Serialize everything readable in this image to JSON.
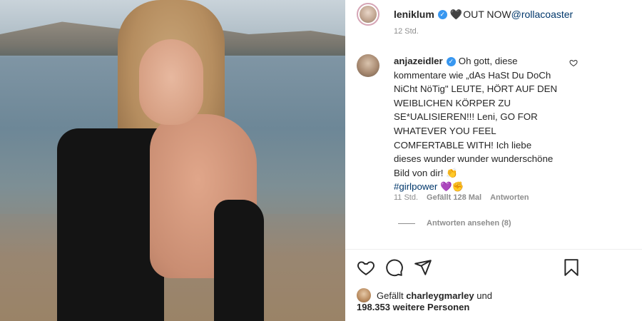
{
  "post": {
    "author": "leniklum",
    "caption_prefix": "🖤",
    "caption_text": "OUT NOW ",
    "caption_handle": "@rollacoaster",
    "timestamp": "12 Std."
  },
  "comment": {
    "author": "anjazeidler",
    "text": "Oh gott, diese kommentare wie „dAs HaSt Du DoCh NiCht NöTig\" LEUTE, HÖRT AUF DEN WEIBLICHEN KÖRPER ZU SE*UALISIEREN!!! Leni, GO FOR WHATEVER YOU FEEL COMFERTABLE WITH! Ich liebe dieses wunder wunder wunderschöne Bild von dir! 👏",
    "hashtag": "#girlpower",
    "emojis": "💜✊",
    "timestamp": "11 Std.",
    "likes": "Gefällt 128 Mal",
    "reply_label": "Antworten",
    "view_replies": "Antworten ansehen (8)"
  },
  "likes_line": {
    "prefix": "Gefällt ",
    "user": "charleygmarley",
    "suffix": " und",
    "others": "198.353 weitere Personen"
  },
  "icons": [
    "verified-badge-icon",
    "heart-outline-icon",
    "comment-icon",
    "share-icon",
    "bookmark-icon"
  ],
  "colors": {
    "accent": "#3897f0",
    "link": "#00376b",
    "muted": "#8e8e8e"
  }
}
